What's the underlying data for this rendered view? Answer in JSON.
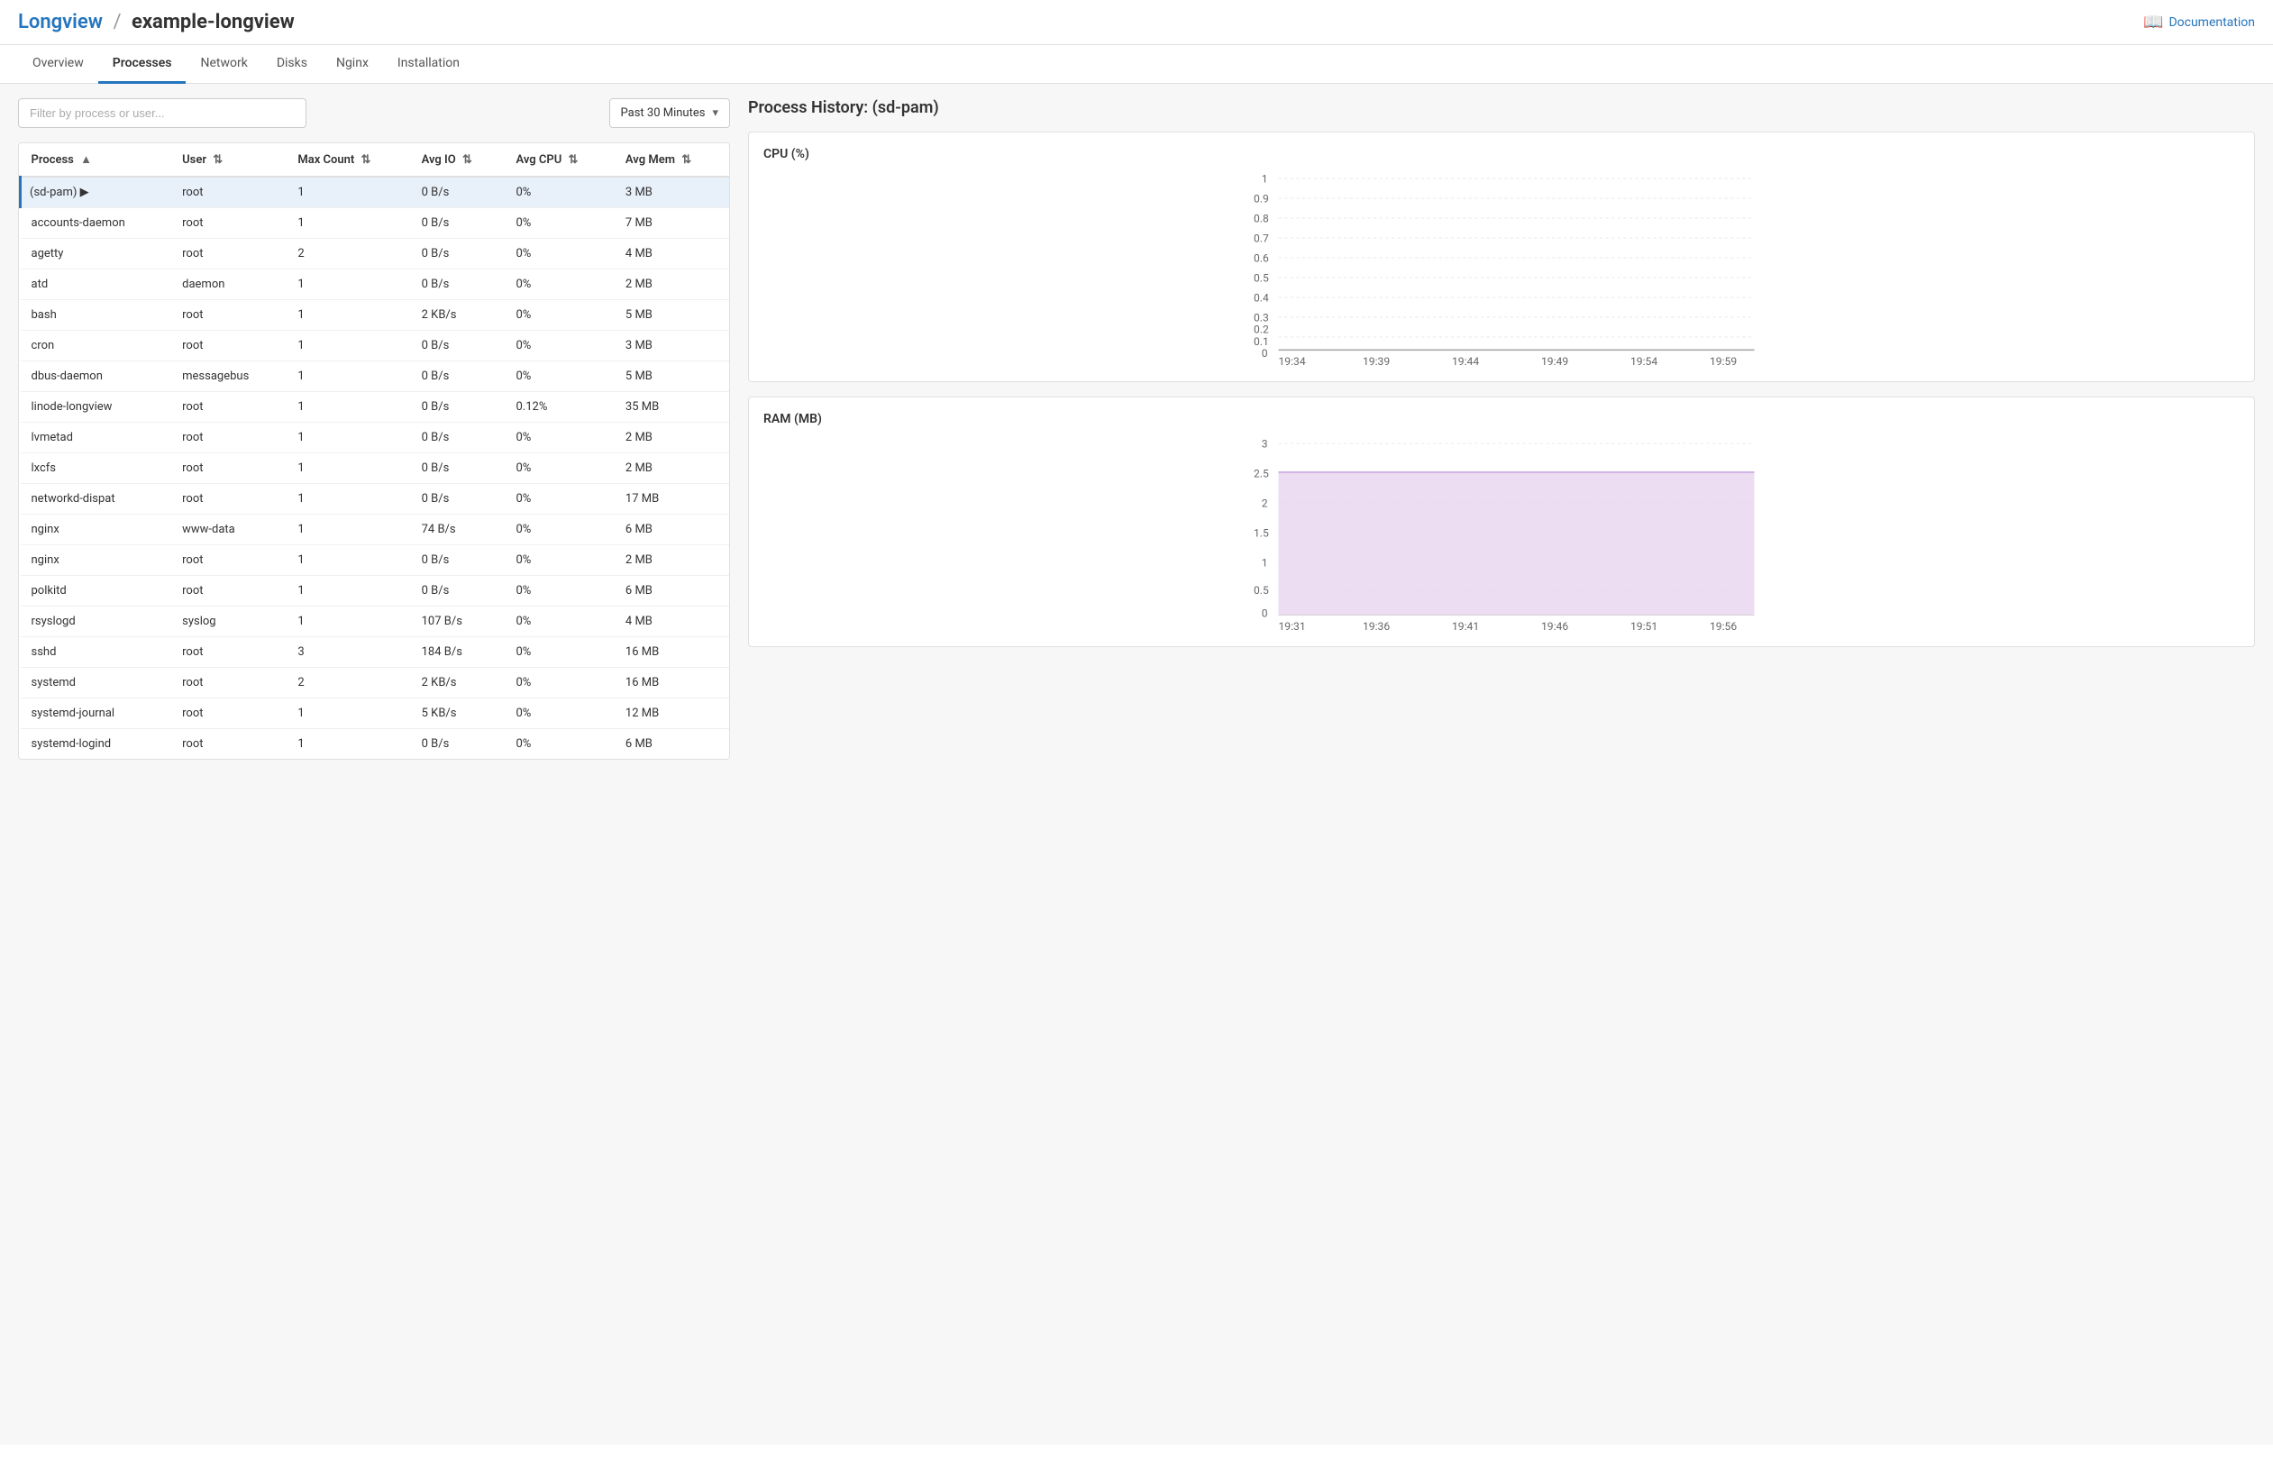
{
  "header": {
    "brand": "Longview",
    "separator": "/",
    "page_name": "example-longview",
    "doc_label": "Documentation"
  },
  "tabs": [
    {
      "id": "overview",
      "label": "Overview",
      "active": false
    },
    {
      "id": "processes",
      "label": "Processes",
      "active": true
    },
    {
      "id": "network",
      "label": "Network",
      "active": false
    },
    {
      "id": "disks",
      "label": "Disks",
      "active": false
    },
    {
      "id": "nginx",
      "label": "Nginx",
      "active": false
    },
    {
      "id": "installation",
      "label": "Installation",
      "active": false
    }
  ],
  "toolbar": {
    "filter_placeholder": "Filter by process or user...",
    "time_select_value": "Past 30 Minutes"
  },
  "table": {
    "columns": [
      {
        "id": "process",
        "label": "Process",
        "sort": "asc"
      },
      {
        "id": "user",
        "label": "User",
        "sort": "both"
      },
      {
        "id": "max_count",
        "label": "Max Count",
        "sort": "both"
      },
      {
        "id": "avg_io",
        "label": "Avg IO",
        "sort": "both"
      },
      {
        "id": "avg_cpu",
        "label": "Avg CPU",
        "sort": "both"
      },
      {
        "id": "avg_mem",
        "label": "Avg Mem",
        "sort": "both"
      }
    ],
    "rows": [
      {
        "process": "(sd-pam)",
        "user": "root",
        "max_count": "1",
        "avg_io": "0 B/s",
        "avg_cpu": "0%",
        "avg_mem": "3 MB",
        "selected": true
      },
      {
        "process": "accounts-daemon",
        "user": "root",
        "max_count": "1",
        "avg_io": "0 B/s",
        "avg_cpu": "0%",
        "avg_mem": "7 MB",
        "selected": false
      },
      {
        "process": "agetty",
        "user": "root",
        "max_count": "2",
        "avg_io": "0 B/s",
        "avg_cpu": "0%",
        "avg_mem": "4 MB",
        "selected": false
      },
      {
        "process": "atd",
        "user": "daemon",
        "max_count": "1",
        "avg_io": "0 B/s",
        "avg_cpu": "0%",
        "avg_mem": "2 MB",
        "selected": false
      },
      {
        "process": "bash",
        "user": "root",
        "max_count": "1",
        "avg_io": "2 KB/s",
        "avg_cpu": "0%",
        "avg_mem": "5 MB",
        "selected": false
      },
      {
        "process": "cron",
        "user": "root",
        "max_count": "1",
        "avg_io": "0 B/s",
        "avg_cpu": "0%",
        "avg_mem": "3 MB",
        "selected": false
      },
      {
        "process": "dbus-daemon",
        "user": "messagebus",
        "max_count": "1",
        "avg_io": "0 B/s",
        "avg_cpu": "0%",
        "avg_mem": "5 MB",
        "selected": false
      },
      {
        "process": "linode-longview",
        "user": "root",
        "max_count": "1",
        "avg_io": "0 B/s",
        "avg_cpu": "0.12%",
        "avg_mem": "35 MB",
        "selected": false
      },
      {
        "process": "lvmetad",
        "user": "root",
        "max_count": "1",
        "avg_io": "0 B/s",
        "avg_cpu": "0%",
        "avg_mem": "2 MB",
        "selected": false
      },
      {
        "process": "lxcfs",
        "user": "root",
        "max_count": "1",
        "avg_io": "0 B/s",
        "avg_cpu": "0%",
        "avg_mem": "2 MB",
        "selected": false
      },
      {
        "process": "networkd-dispat",
        "user": "root",
        "max_count": "1",
        "avg_io": "0 B/s",
        "avg_cpu": "0%",
        "avg_mem": "17 MB",
        "selected": false
      },
      {
        "process": "nginx",
        "user": "www-data",
        "max_count": "1",
        "avg_io": "74 B/s",
        "avg_cpu": "0%",
        "avg_mem": "6 MB",
        "selected": false
      },
      {
        "process": "nginx",
        "user": "root",
        "max_count": "1",
        "avg_io": "0 B/s",
        "avg_cpu": "0%",
        "avg_mem": "2 MB",
        "selected": false
      },
      {
        "process": "polkitd",
        "user": "root",
        "max_count": "1",
        "avg_io": "0 B/s",
        "avg_cpu": "0%",
        "avg_mem": "6 MB",
        "selected": false
      },
      {
        "process": "rsyslogd",
        "user": "syslog",
        "max_count": "1",
        "avg_io": "107 B/s",
        "avg_cpu": "0%",
        "avg_mem": "4 MB",
        "selected": false
      },
      {
        "process": "sshd",
        "user": "root",
        "max_count": "3",
        "avg_io": "184 B/s",
        "avg_cpu": "0%",
        "avg_mem": "16 MB",
        "selected": false
      },
      {
        "process": "systemd",
        "user": "root",
        "max_count": "2",
        "avg_io": "2 KB/s",
        "avg_cpu": "0%",
        "avg_mem": "16 MB",
        "selected": false
      },
      {
        "process": "systemd-journal",
        "user": "root",
        "max_count": "1",
        "avg_io": "5 KB/s",
        "avg_cpu": "0%",
        "avg_mem": "12 MB",
        "selected": false
      },
      {
        "process": "systemd-logind",
        "user": "root",
        "max_count": "1",
        "avg_io": "0 B/s",
        "avg_cpu": "0%",
        "avg_mem": "6 MB",
        "selected": false
      }
    ]
  },
  "right_panel": {
    "title": "Process History: (sd-pam)",
    "cpu_chart": {
      "label": "CPU (%)",
      "y_labels": [
        "1",
        "0.9",
        "0.8",
        "0.7",
        "0.6",
        "0.5",
        "0.4",
        "0.3",
        "0.2",
        "0.1",
        "0"
      ],
      "x_labels": [
        "19:34",
        "19:39",
        "19:44",
        "19:49",
        "19:54",
        "19:59"
      ]
    },
    "ram_chart": {
      "label": "RAM (MB)",
      "y_labels": [
        "3",
        "2.5",
        "2",
        "1.5",
        "1",
        "0.5",
        "0"
      ],
      "x_labels": [
        "19:31",
        "19:36",
        "19:41",
        "19:46",
        "19:51",
        "19:56"
      ]
    }
  }
}
